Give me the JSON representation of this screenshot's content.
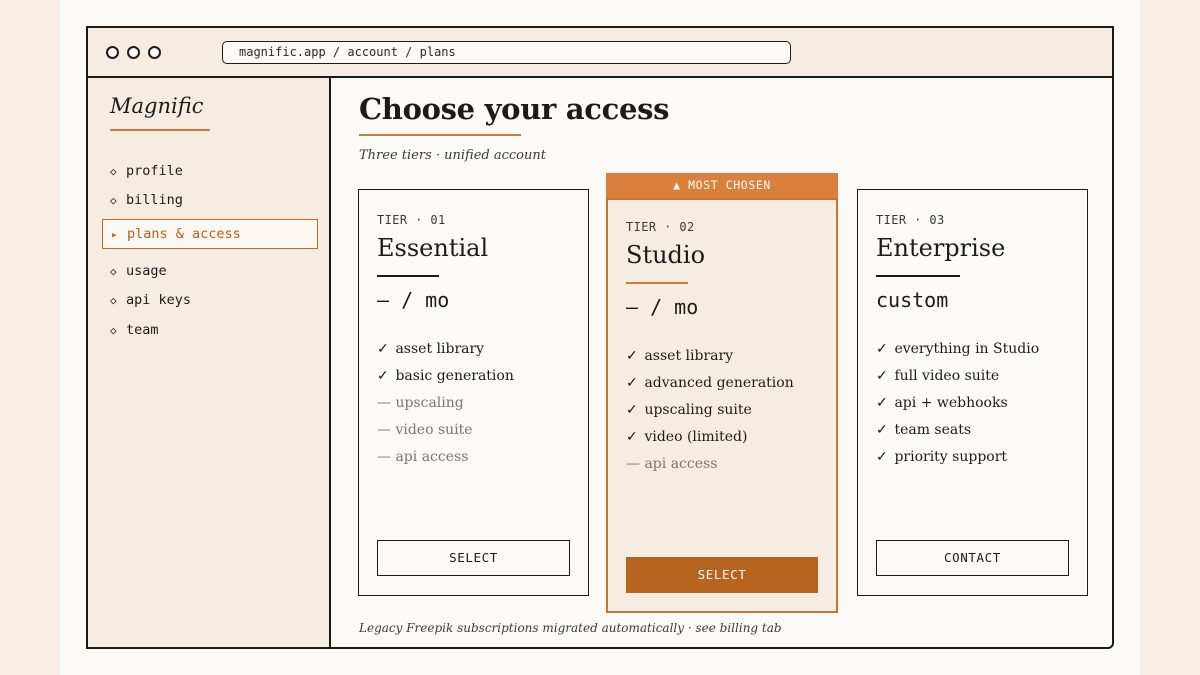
{
  "browser": {
    "url": "magnific.app / account / plans"
  },
  "sidebar": {
    "brand": "Magnific",
    "items": [
      {
        "label": "profile",
        "bullet": "◇"
      },
      {
        "label": "billing",
        "bullet": "◇"
      },
      {
        "label": "plans & access",
        "bullet": "▸",
        "active": true
      },
      {
        "label": "usage",
        "bullet": "◇"
      },
      {
        "label": "api keys",
        "bullet": "◇"
      },
      {
        "label": "team",
        "bullet": "◇"
      }
    ]
  },
  "main": {
    "title": "Choose your access",
    "subtitle": "Three tiers · unified account",
    "footnote": "Legacy Freepik subscriptions migrated automatically · see billing tab"
  },
  "plans": [
    {
      "tier": "TIER · 01",
      "name": "Essential",
      "price": "— / mo",
      "features": [
        {
          "mark": "✓",
          "text": "asset library"
        },
        {
          "mark": "✓",
          "text": "basic generation"
        },
        {
          "mark": "—",
          "text": "upscaling",
          "off": true
        },
        {
          "mark": "—",
          "text": "video suite",
          "off": true
        },
        {
          "mark": "—",
          "text": "api access",
          "off": true
        }
      ],
      "button": "SELECT"
    },
    {
      "badge": "▲ MOST CHOSEN",
      "tier": "TIER · 02",
      "name": "Studio",
      "price": "— / mo",
      "features": [
        {
          "mark": "✓",
          "text": "asset library"
        },
        {
          "mark": "✓",
          "text": "advanced generation"
        },
        {
          "mark": "✓",
          "text": "upscaling suite"
        },
        {
          "mark": "✓",
          "text": "video (limited)"
        },
        {
          "mark": "—",
          "text": "api access",
          "off": true
        }
      ],
      "button": "SELECT"
    },
    {
      "tier": "TIER · 03",
      "name": "Enterprise",
      "price": "custom",
      "features": [
        {
          "mark": "✓",
          "text": "everything in Studio"
        },
        {
          "mark": "✓",
          "text": "full video suite"
        },
        {
          "mark": "✓",
          "text": "api + webhooks"
        },
        {
          "mark": "✓",
          "text": "team seats"
        },
        {
          "mark": "✓",
          "text": "priority support"
        }
      ],
      "button": "CONTACT"
    }
  ],
  "colors": {
    "accent": "#d17a35",
    "accent_dark": "#b86421",
    "ink": "#1b1b1b",
    "panel": "#f6ede2",
    "paper": "#fcfaf6"
  }
}
